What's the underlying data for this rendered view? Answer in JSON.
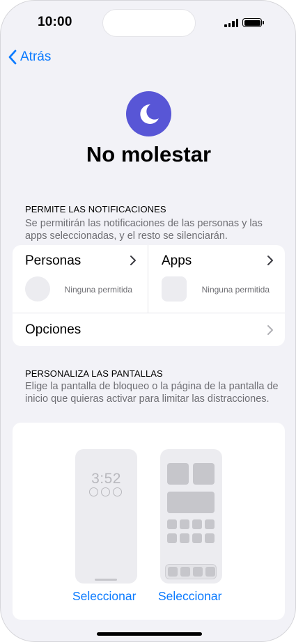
{
  "status_bar": {
    "time": "10:00"
  },
  "nav": {
    "back_label": "Atrás"
  },
  "header": {
    "title": "No molestar",
    "icon": "moon-icon",
    "icon_color": "#5856d6"
  },
  "notifications": {
    "heading": "PERMITE LAS NOTIFICACIONES",
    "description": "Se permitirán las notificaciones de las personas y las apps seleccionadas, y el resto se silenciarán.",
    "people": {
      "label": "Personas",
      "status": "Ninguna permitida"
    },
    "apps": {
      "label": "Apps",
      "status": "Ninguna permitida"
    },
    "options_label": "Opciones"
  },
  "screens": {
    "heading": "PERSONALIZA LAS PANTALLAS",
    "description": "Elige la pantalla de bloqueo o la página de la pantalla de inicio que quieras activar para limitar las distracciones.",
    "lock_screen_time": "3:52",
    "lock_select_label": "Seleccionar",
    "home_select_label": "Seleccionar"
  },
  "colors": {
    "accent": "#0a7aff",
    "background": "#f2f2f7"
  }
}
